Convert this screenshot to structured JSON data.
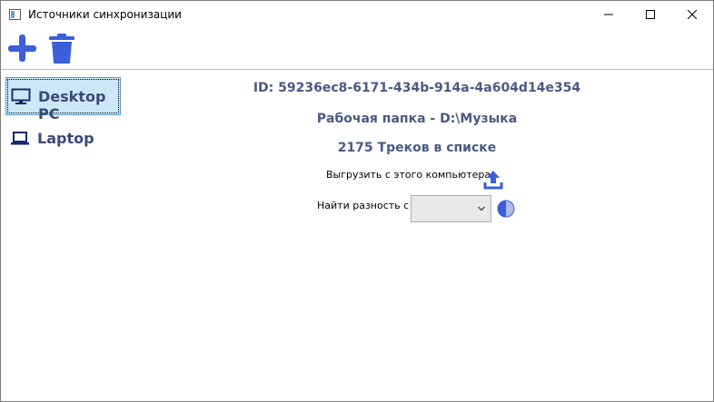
{
  "window": {
    "title": "Источники синхронизации"
  },
  "toolbar": {
    "add_icon": "plus-icon",
    "delete_icon": "trash-icon"
  },
  "sidebar": {
    "items": [
      {
        "label": "Desktop PC",
        "icon": "desktop-icon",
        "selected": true
      },
      {
        "label": "Laptop",
        "icon": "laptop-icon",
        "selected": false
      }
    ]
  },
  "details": {
    "id_line": "ID: 59236ec8-6171-434b-914a-4a604d14e354",
    "folder_line": "Рабочая папка - D:\\Музыка",
    "tracks_line": "2175 Треков в списке",
    "upload_label": "Выгрузить с этого компьютера",
    "upload_icon": "upload-icon",
    "diff_label": "Найти разность с",
    "diff_select_value": "",
    "compare_icon": "contrast-icon"
  },
  "colors": {
    "accent": "#3b5fd8",
    "label_text": "#3a4a78",
    "selection_bg": "#cce8f7",
    "selection_border": "#5b9ccc"
  }
}
